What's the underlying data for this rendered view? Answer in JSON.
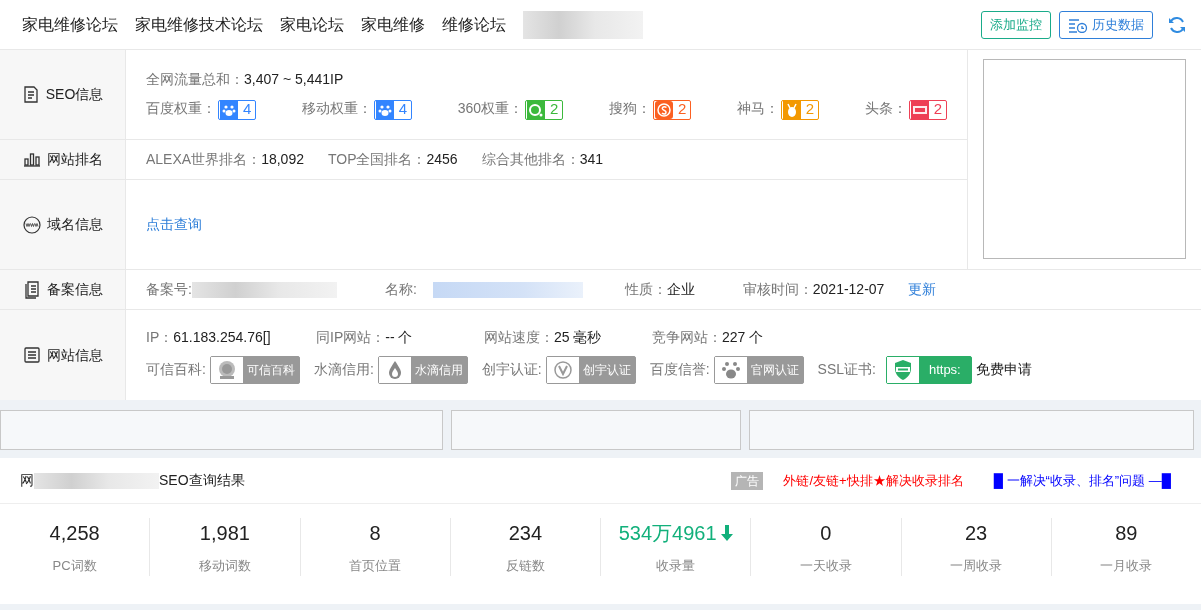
{
  "nav": {
    "links": [
      "家电维修论坛",
      "家电维修技术论坛",
      "家电论坛",
      "家电维修",
      "维修论坛"
    ],
    "buttons": [
      {
        "label": "添加监控",
        "kind": "monitor"
      },
      {
        "label": "历史数据",
        "kind": "history"
      }
    ]
  },
  "seo": {
    "label": "SEO信息",
    "traffic_label": "全网流量总和：",
    "traffic_value": "3,407 ~ 5,441IP",
    "weights": [
      {
        "label": "百度权重：",
        "value": "4",
        "kind": "baidu",
        "color": "#3385ff"
      },
      {
        "label": "移动权重：",
        "value": "4",
        "kind": "baidu",
        "color": "#3385ff"
      },
      {
        "label": "360权重：",
        "value": "2",
        "kind": "qihoo",
        "color": "#3cb93c"
      },
      {
        "label": "搜狗：",
        "value": "2",
        "kind": "sogou",
        "color": "#fb6022"
      },
      {
        "label": "神马：",
        "value": "2",
        "kind": "shenma",
        "color": "#f39800"
      },
      {
        "label": "头条：",
        "value": "2",
        "kind": "toutiao",
        "color": "#ee4056"
      }
    ]
  },
  "rank": {
    "label": "网站排名",
    "items": [
      {
        "label": "ALEXA世界排名：",
        "value": "18,092"
      },
      {
        "label": "TOP全国排名：",
        "value": "2456"
      },
      {
        "label": "综合其他排名：",
        "value": "341"
      }
    ]
  },
  "domain": {
    "label": "域名信息",
    "link": "点击查询"
  },
  "beian": {
    "label": "备案信息",
    "number_label": "备案号:",
    "name_label": "名称:",
    "nature_label": "性质：",
    "nature": "企业",
    "date_label": "审核时间：",
    "date": "2021-12-07",
    "update": "更新"
  },
  "site": {
    "label": "网站信息",
    "facts": [
      {
        "label": "IP：",
        "value": "61.183.254.76[]"
      },
      {
        "label": "同IP网站：",
        "value": "-- 个"
      },
      {
        "label": "网站速度：",
        "value": "25 毫秒"
      },
      {
        "label": "竞争网站：",
        "value": "227 个"
      }
    ],
    "credentials": [
      {
        "label": "可信百科:",
        "badge": "可信百科",
        "kind": "seal"
      },
      {
        "label": "水滴信用:",
        "badge": "水滴信用",
        "kind": "drop"
      },
      {
        "label": "创宇认证:",
        "badge": "创宇认证",
        "kind": "v"
      },
      {
        "label": "百度信誉:",
        "badge": "官网认证",
        "kind": "paw"
      },
      {
        "label": "SSL证书:",
        "badge": "https:",
        "kind": "ssl",
        "extra": "免费申请"
      }
    ]
  },
  "results": {
    "title_start": "网",
    "title_end": "SEO查询结果",
    "ad_tag": "广告",
    "ad_links": [
      {
        "text": "外链/友链+快排★解决收录排名",
        "color": "#ff0000"
      },
      {
        "text": "█ 一解决“收录、排名”问题 —█",
        "color": "#0000ff"
      }
    ],
    "stats": [
      {
        "value": "4,258",
        "label": "PC词数"
      },
      {
        "value": "1,981",
        "label": "移动词数"
      },
      {
        "value": "8",
        "label": "首页位置"
      },
      {
        "value": "234",
        "label": "反链数"
      },
      {
        "value": "534万4961",
        "label": "收录量",
        "falling": true
      },
      {
        "value": "0",
        "label": "一天收录"
      },
      {
        "value": "23",
        "label": "一周收录"
      },
      {
        "value": "89",
        "label": "一月收录"
      }
    ]
  }
}
